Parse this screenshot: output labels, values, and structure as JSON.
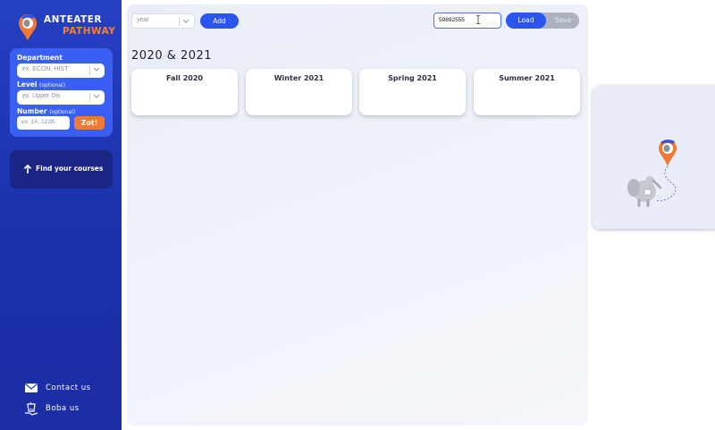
{
  "app": {
    "logo_line1": "ANTEATER",
    "logo_line2": "PATHWAY",
    "logo_icon": "anteater-pin-icon"
  },
  "sidebar": {
    "search": {
      "department_label": "Department",
      "department_placeholder": "ex. ECON, HIST",
      "level_label": "Level",
      "level_optional": "(optional)",
      "level_placeholder": "ex. Upper Div.",
      "number_label": "Number",
      "number_optional": "(optional)",
      "number_placeholder": "ex. 1A, 122B",
      "zot_label": "Zot!"
    },
    "find_courses_label": "Find your courses",
    "contact_label": "Contact us",
    "boba_label": "Boba us"
  },
  "toolbar": {
    "year_placeholder": "year",
    "add_label": "Add",
    "plan_input_value": "59892555",
    "load_label": "Load",
    "save_label": "Save"
  },
  "planner": {
    "year_title": "2020 & 2021",
    "quarters": [
      {
        "label": "Fall 2020"
      },
      {
        "label": "Winter 2021"
      },
      {
        "label": "Spring 2021"
      },
      {
        "label": "Summer 2021"
      }
    ]
  },
  "colors": {
    "sidebar_blue": "#1f35b3",
    "search_box_blue": "#3960f2",
    "accent_orange": "#f07a35",
    "primary_button": "#2a55ee",
    "find_button_bg": "#1b2583"
  }
}
